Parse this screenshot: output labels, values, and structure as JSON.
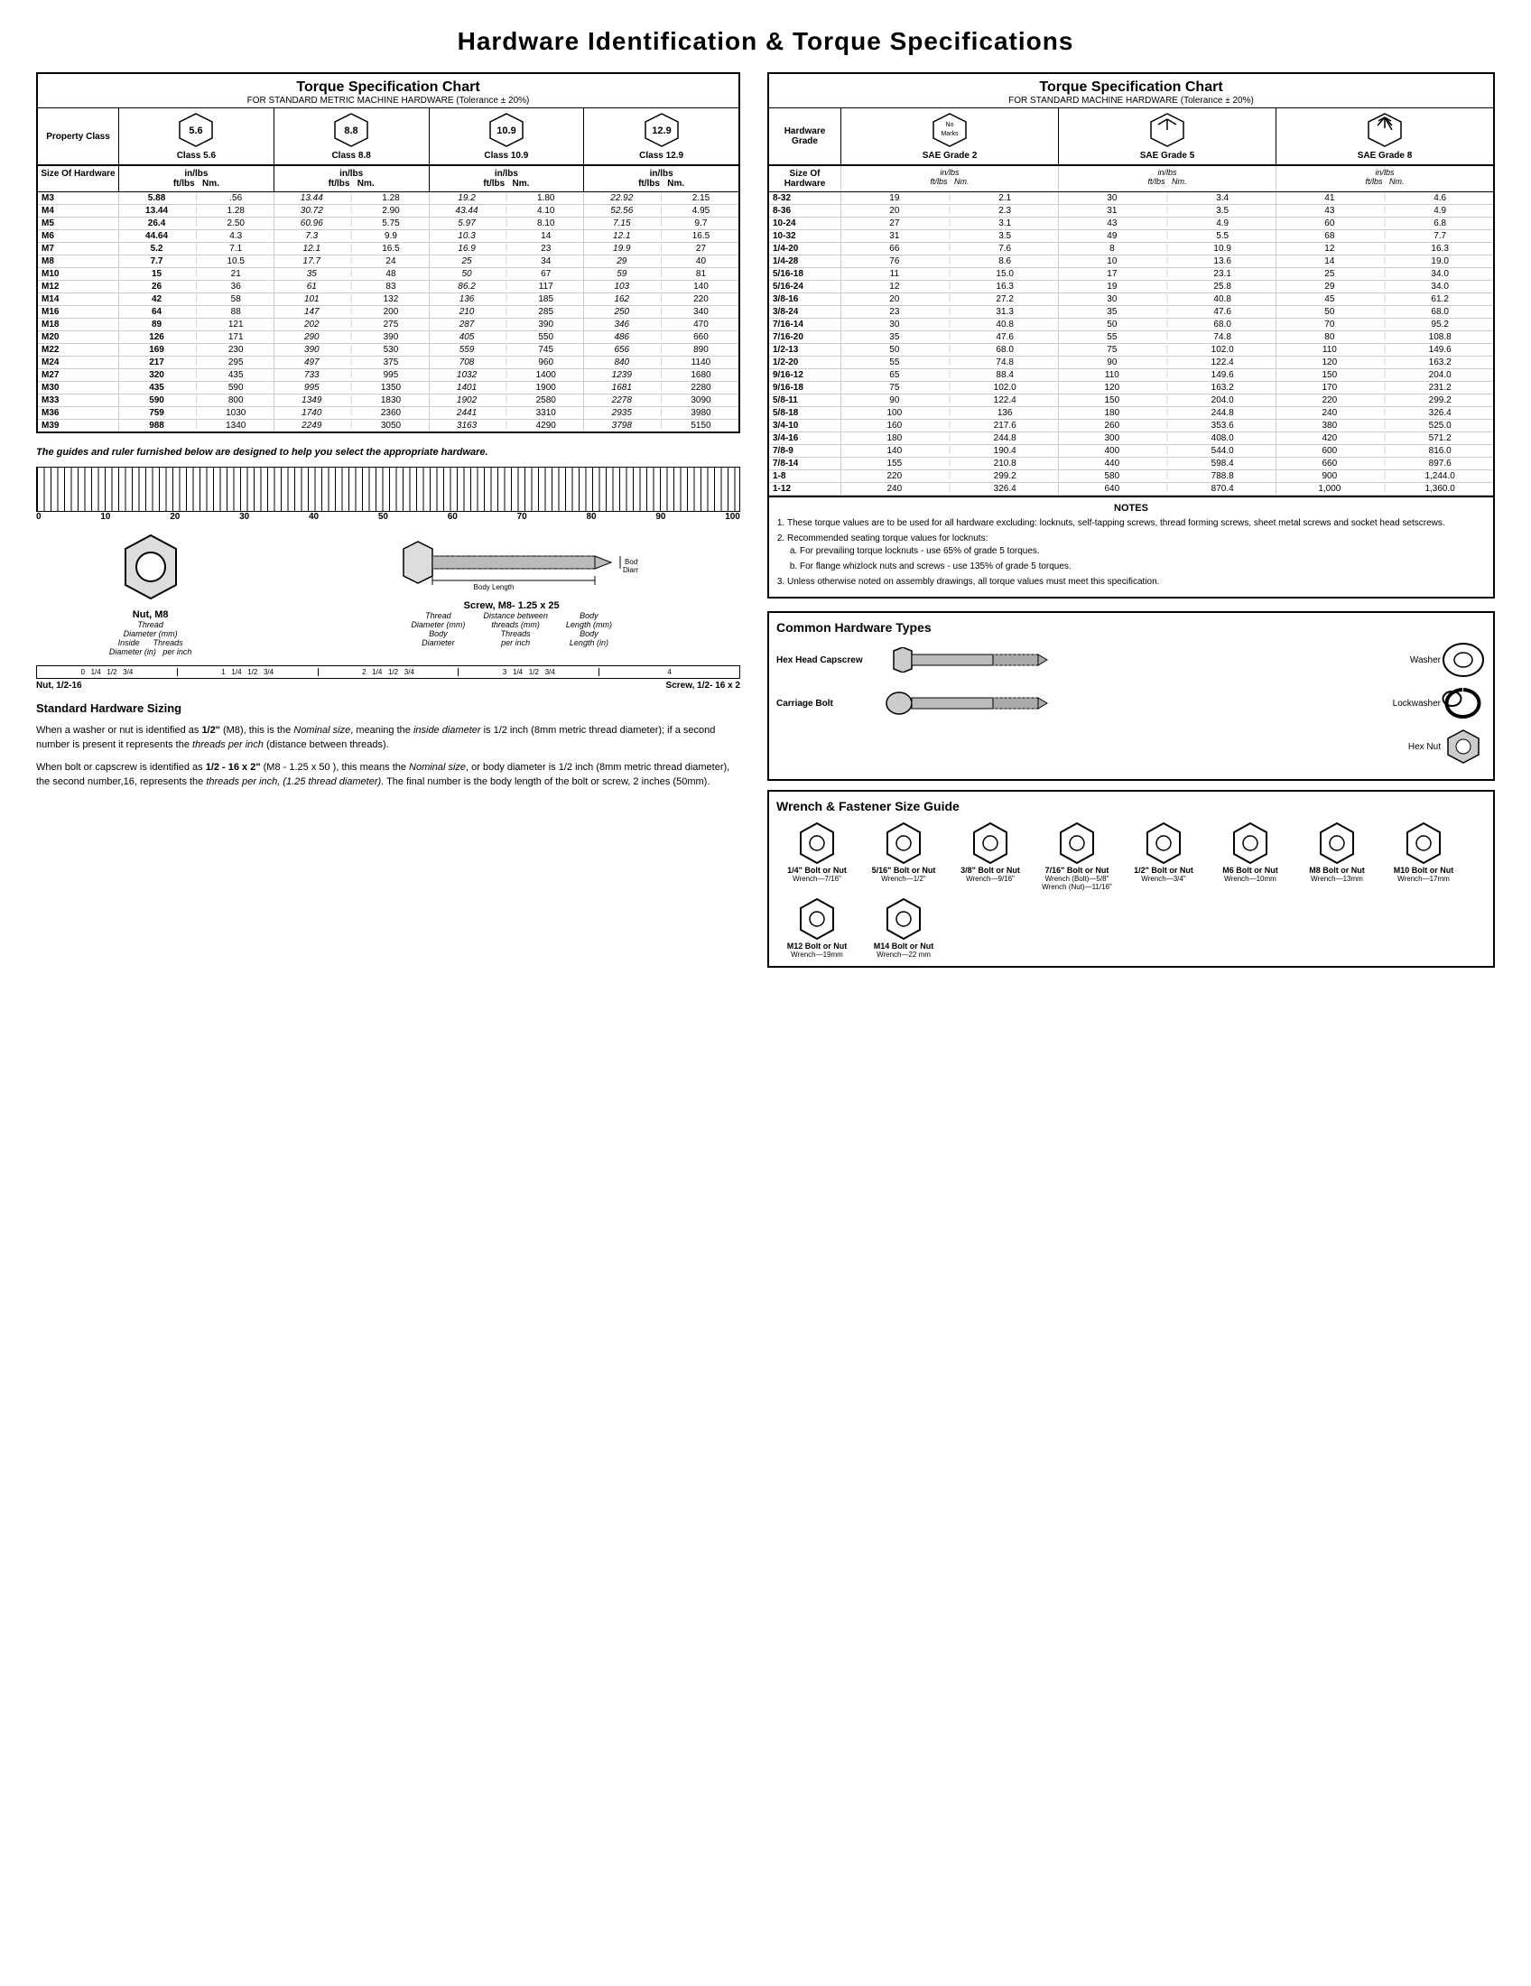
{
  "title": "Hardware Identification  &  Torque Specifications",
  "left_chart": {
    "title": "Torque Specification Chart",
    "subtitle": "FOR STANDARD METRIC MACHINE HARDWARE (Tolerance ± 20%)",
    "property_class_label": "Property Class",
    "classes": [
      {
        "label": "5.6",
        "class_label": "Class 5.6"
      },
      {
        "label": "8.8",
        "class_label": "Class 8.8"
      },
      {
        "label": "10.9",
        "class_label": "Class 10.9"
      },
      {
        "label": "12.9",
        "class_label": "Class 12.9"
      }
    ],
    "size_of_hardware": "Size Of Hardware",
    "units": [
      "in/lbs ft/lbs",
      "Nm.",
      "in/lbs ft/lbs",
      "Nm.",
      "in/lbs ft/lbs",
      "Nm.",
      "in/lbs ft/lbs",
      "Nm."
    ],
    "rows": [
      {
        "size": "M3",
        "v": [
          "5.88",
          ".56",
          "13.44",
          "1.28",
          "19.2",
          "1.80",
          "22.92",
          "2.15"
        ]
      },
      {
        "size": "M4",
        "v": [
          "13.44",
          "1.28",
          "30.72",
          "2.90",
          "43.44",
          "4.10",
          "52.56",
          "4.95"
        ]
      },
      {
        "size": "M5",
        "v": [
          "26.4",
          "2.50",
          "60.96",
          "5.75",
          "5.97",
          "8.10",
          "7.15",
          "9.7"
        ]
      },
      {
        "size": "M6",
        "v": [
          "44.64",
          "4.3",
          "7.3",
          "9.9",
          "10.3",
          "14",
          "12.1",
          "16.5"
        ]
      },
      {
        "size": "M7",
        "v": [
          "5.2",
          "7.1",
          "12.1",
          "16.5",
          "16.9",
          "23",
          "19.9",
          "27"
        ]
      },
      {
        "size": "M8",
        "v": [
          "7.7",
          "10.5",
          "17.7",
          "24",
          "25",
          "34",
          "29",
          "40"
        ]
      },
      {
        "size": "M10",
        "v": [
          "15",
          "21",
          "35",
          "48",
          "50",
          "67",
          "59",
          "81"
        ]
      },
      {
        "size": "M12",
        "v": [
          "26",
          "36",
          "61",
          "83",
          "86.2",
          "117",
          "103",
          "140"
        ]
      },
      {
        "size": "M14",
        "v": [
          "42",
          "58",
          "101",
          "132",
          "136",
          "185",
          "162",
          "220"
        ]
      },
      {
        "size": "M16",
        "v": [
          "64",
          "88",
          "147",
          "200",
          "210",
          "285",
          "250",
          "340"
        ]
      },
      {
        "size": "M18",
        "v": [
          "89",
          "121",
          "202",
          "275",
          "287",
          "390",
          "346",
          "470"
        ]
      },
      {
        "size": "M20",
        "v": [
          "126",
          "171",
          "290",
          "390",
          "405",
          "550",
          "486",
          "660"
        ]
      },
      {
        "size": "M22",
        "v": [
          "169",
          "230",
          "390",
          "530",
          "559",
          "745",
          "656",
          "890"
        ]
      },
      {
        "size": "M24",
        "v": [
          "217",
          "295",
          "497",
          "375",
          "708",
          "960",
          "840",
          "1140"
        ]
      },
      {
        "size": "M27",
        "v": [
          "320",
          "435",
          "733",
          "995",
          "1032",
          "1400",
          "1239",
          "1680"
        ]
      },
      {
        "size": "M30",
        "v": [
          "435",
          "590",
          "995",
          "1350",
          "1401",
          "1900",
          "1681",
          "2280"
        ]
      },
      {
        "size": "M33",
        "v": [
          "590",
          "800",
          "1349",
          "1830",
          "1902",
          "2580",
          "2278",
          "3090"
        ]
      },
      {
        "size": "M36",
        "v": [
          "759",
          "1030",
          "1740",
          "2360",
          "2441",
          "3310",
          "2935",
          "3980"
        ]
      },
      {
        "size": "M39",
        "v": [
          "988",
          "1340",
          "2249",
          "3050",
          "3163",
          "4290",
          "3798",
          "5150"
        ]
      }
    ]
  },
  "guide_text": "The guides and ruler furnished below are designed to help you select the appropriate hardware.",
  "ruler_numbers": [
    "0",
    "10",
    "20",
    "30",
    "40",
    "50",
    "60",
    "70",
    "80",
    "90",
    "100"
  ],
  "nut_label": "Nut, M8",
  "nut_sub": [
    "Thread",
    "Diameter (mm)",
    "Inside",
    "Diameter (in)",
    "Threads",
    "per inch"
  ],
  "screw_label": "Screw, M8- 1.25 x 25",
  "screw_sub": [
    "Thread",
    "Diameter (mm)",
    "Body",
    "Diameter",
    "Distance between",
    "threads (mm)",
    "Threads",
    "per inch",
    "Body",
    "Length (mm)",
    "Body",
    "Length (in)"
  ],
  "nut_label2": "Nut, 1/2-16",
  "screw_label2": "Screw, 1/2- 16 x 2",
  "std_sizing_title": "Standard Hardware Sizing",
  "std_sizing_p1": "When a washer or nut is identified as 1/2\" (M8), this is the Nominal size, meaning the inside diameter is 1/2 inch (8mm metric thread diameter); if a second number is present it represents the threads per inch (distance between threads).",
  "std_sizing_p2": "When bolt or capscrew is identified as 1/2 - 16 x 2\" (M8 - 1.25 x 50 ), this means the Nominal size, or body diameter is 1/2 inch (8mm metric thread diameter), the second number,16, represents the threads per inch, (1.25 thread diameter). The final number is the body length of the bolt or screw, 2 inches (50mm).",
  "right_chart": {
    "title": "Torque Specification Chart",
    "subtitle": "FOR STANDARD MACHINE HARDWARE (Tolerance ± 20%)",
    "hardware_grade_label": "Hardware Grade",
    "grades": [
      "SAE Grade 2",
      "SAE Grade 5",
      "SAE Grade 8"
    ],
    "size_of_hardware": "Size Of Hardware",
    "col_headers": [
      "Hardware Grade",
      "No Marks SAE Grade 2",
      "SAE Grade 5",
      "SAE Grade 8"
    ],
    "data_cols": [
      "Size",
      "in/lbs ft/lbs",
      "Nm.",
      "in/lbs ft/lbs",
      "Nm.",
      "in/lbs ft/lbs",
      "Nm."
    ],
    "rows": [
      {
        "size": "8-32",
        "v": [
          "19",
          "2.1",
          "30",
          "3.4",
          "41",
          "4.6"
        ]
      },
      {
        "size": "8-36",
        "v": [
          "20",
          "2.3",
          "31",
          "3.5",
          "43",
          "4.9"
        ]
      },
      {
        "size": "10-24",
        "v": [
          "27",
          "3.1",
          "43",
          "4.9",
          "60",
          "6.8"
        ]
      },
      {
        "size": "10-32",
        "v": [
          "31",
          "3.5",
          "49",
          "5.5",
          "68",
          "7.7"
        ]
      },
      {
        "size": "1/4-20",
        "v": [
          "66",
          "7.6",
          "8",
          "10.9",
          "12",
          "16.3"
        ]
      },
      {
        "size": "1/4-28",
        "v": [
          "76",
          "8.6",
          "10",
          "13.6",
          "14",
          "19.0"
        ]
      },
      {
        "size": "5/16-18",
        "v": [
          "11",
          "15.0",
          "17",
          "23.1",
          "25",
          "34.0"
        ]
      },
      {
        "size": "5/16-24",
        "v": [
          "12",
          "16.3",
          "19",
          "25.8",
          "29",
          "34.0"
        ]
      },
      {
        "size": "3/8-16",
        "v": [
          "20",
          "27.2",
          "30",
          "40.8",
          "45",
          "61.2"
        ]
      },
      {
        "size": "3/8-24",
        "v": [
          "23",
          "31.3",
          "35",
          "47.6",
          "50",
          "68.0"
        ]
      },
      {
        "size": "7/16-14",
        "v": [
          "30",
          "40.8",
          "50",
          "68.0",
          "70",
          "95.2"
        ]
      },
      {
        "size": "7/16-20",
        "v": [
          "35",
          "47.6",
          "55",
          "74.8",
          "80",
          "108.8"
        ]
      },
      {
        "size": "1/2-13",
        "v": [
          "50",
          "68.0",
          "75",
          "102.0",
          "110",
          "149.6"
        ]
      },
      {
        "size": "1/2-20",
        "v": [
          "55",
          "74.8",
          "90",
          "122.4",
          "120",
          "163.2"
        ]
      },
      {
        "size": "9/16-12",
        "v": [
          "65",
          "88.4",
          "110",
          "149.6",
          "150",
          "204.0"
        ]
      },
      {
        "size": "9/16-18",
        "v": [
          "75",
          "102.0",
          "120",
          "163.2",
          "170",
          "231.2"
        ]
      },
      {
        "size": "5/8-11",
        "v": [
          "90",
          "122.4",
          "150",
          "204.0",
          "220",
          "299.2"
        ]
      },
      {
        "size": "5/8-18",
        "v": [
          "100",
          "136",
          "180",
          "244.8",
          "240",
          "326.4"
        ]
      },
      {
        "size": "3/4-10",
        "v": [
          "160",
          "217.6",
          "260",
          "353.6",
          "380",
          "525.0"
        ]
      },
      {
        "size": "3/4-16",
        "v": [
          "180",
          "244.8",
          "300",
          "408.0",
          "420",
          "571.2"
        ]
      },
      {
        "size": "7/8-9",
        "v": [
          "140",
          "190.4",
          "400",
          "544.0",
          "600",
          "816.0"
        ]
      },
      {
        "size": "7/8-14",
        "v": [
          "155",
          "210.8",
          "440",
          "598.4",
          "660",
          "897.6"
        ]
      },
      {
        "size": "1-8",
        "v": [
          "220",
          "299.2",
          "580",
          "788.8",
          "900",
          "1,244.0"
        ]
      },
      {
        "size": "1-12",
        "v": [
          "240",
          "326.4",
          "640",
          "870.4",
          "1,000",
          "1,360.0"
        ]
      }
    ]
  },
  "notes": {
    "title": "NOTES",
    "items": [
      "These torque values are to be used for all hardware excluding: locknuts, self-tapping screws, thread forming screws, sheet metal screws and socket head setscrews.",
      "Recommended seating torque values for locknuts:",
      "Unless otherwise noted on assembly drawings, all torque values must meet this specification."
    ],
    "sub_items_2": [
      "For prevailing torque locknuts - use 65% of grade 5 torques.",
      "For flange whizlock nuts and screws - use 135% of grade 5 torques."
    ]
  },
  "common_hw": {
    "title": "Common Hardware Types",
    "items": [
      {
        "label": "Hex Head Capscrew",
        "right_label": "Washer"
      },
      {
        "label": "Carriage Bolt",
        "right_label": "Lockwasher"
      },
      {
        "label": "",
        "right_label": "Hex Nut"
      }
    ]
  },
  "wrench_guide": {
    "title": "Wrench & Fastener Size Guide",
    "items": [
      {
        "label": "1/4\" Bolt or Nut",
        "sub": "Wrench—7/16\""
      },
      {
        "label": "5/16\" Bolt or Nut",
        "sub": "Wrench—1/2\""
      },
      {
        "label": "3/8\" Bolt or Nut",
        "sub": "Wrench—9/16\""
      },
      {
        "label": "7/16\" Bolt or Nut",
        "sub": "Wrench (Bolt)—5/8\"\nWrench (Nut)—11/16\""
      },
      {
        "label": "1/2\" Bolt or Nut",
        "sub": "Wrench—3/4\""
      },
      {
        "label": "M6 Bolt or Nut",
        "sub": "Wrench—10mm"
      },
      {
        "label": "M8 Bolt or Nut",
        "sub": "Wrench—13mm"
      },
      {
        "label": "M10 Bolt or Nut",
        "sub": "Wrench—17mm"
      },
      {
        "label": "M12 Bolt or Nut",
        "sub": "Wrench—19mm"
      },
      {
        "label": "M14 Bolt or Nut",
        "sub": "Wrench—22 mm"
      }
    ]
  }
}
